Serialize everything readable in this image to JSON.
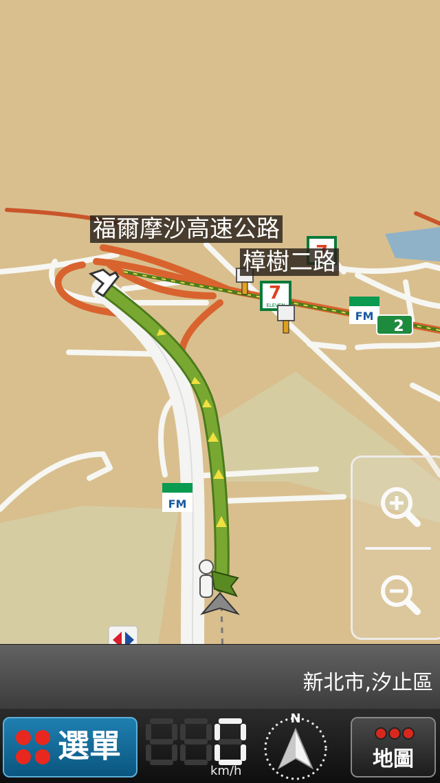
{
  "map": {
    "road_labels": [
      "福爾摩沙高速公路",
      "樟樹二路"
    ],
    "highway_shield": "2",
    "poi_store_text": "ELEVEN",
    "poi_fm_text": "FM",
    "icons": [
      "turn-right-arrow-icon",
      "seven-eleven-icon",
      "familymart-icon",
      "carrefour-icon",
      "speed-camera-icon",
      "vehicle-position-icon",
      "destination-flag-icon"
    ]
  },
  "zoom": {
    "zoom_in_icon": "zoom-in-icon",
    "zoom_out_icon": "zoom-out-icon"
  },
  "location": {
    "current_area": "新北市,汐止區"
  },
  "bottom_bar": {
    "menu_label": "選單",
    "speed_value": "0",
    "speed_unit": "km/h",
    "compass_label": "N",
    "map_label": "地圖"
  },
  "colors": {
    "land": "#d9bf8e",
    "highway": "#c9552a",
    "route": "#6b9a2a",
    "menu_button": "#1278ab"
  }
}
